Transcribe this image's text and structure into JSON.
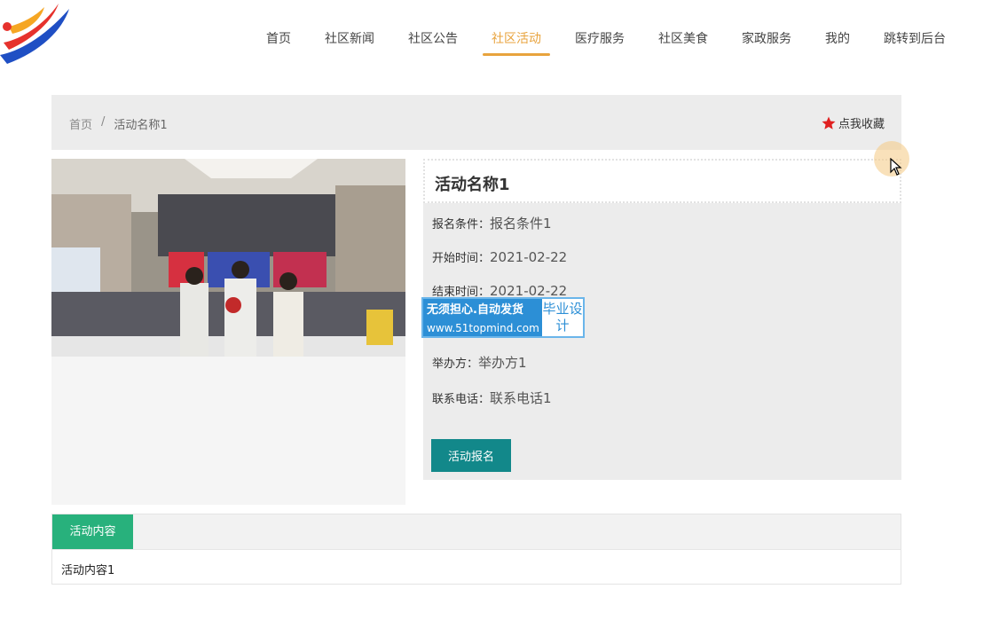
{
  "nav": {
    "items": [
      {
        "label": "首页"
      },
      {
        "label": "社区新闻"
      },
      {
        "label": "社区公告"
      },
      {
        "label": "社区活动",
        "active": true
      },
      {
        "label": "医疗服务"
      },
      {
        "label": "社区美食"
      },
      {
        "label": "家政服务"
      },
      {
        "label": "我的"
      },
      {
        "label": "跳转到后台"
      }
    ]
  },
  "breadcrumb": {
    "home": "首页",
    "separator": "/",
    "current": "活动名称1"
  },
  "favorite": {
    "label": "点我收藏",
    "icon": "star-icon",
    "color": "#e02020"
  },
  "activity": {
    "title": "活动名称1",
    "fields": [
      {
        "label": "报名条件：",
        "value": "报名条件1"
      },
      {
        "label": "开始时间：",
        "value": "2021-02-22"
      },
      {
        "label": "结束时间：",
        "value": "2021-02-22"
      },
      {
        "label": "举办方：",
        "value": "举办方1"
      },
      {
        "label": "联系电话：",
        "value": "联系电话1"
      }
    ],
    "signup_label": "活动报名"
  },
  "watermark": {
    "line1": "无须担心.自动发货",
    "line2": "www.51topmind.com",
    "side": "毕业设计"
  },
  "content": {
    "tab_label": "活动内容",
    "body": "活动内容1"
  },
  "colors": {
    "accent": "#e8a33d",
    "button": "#12888a",
    "tab": "#28b17c"
  }
}
